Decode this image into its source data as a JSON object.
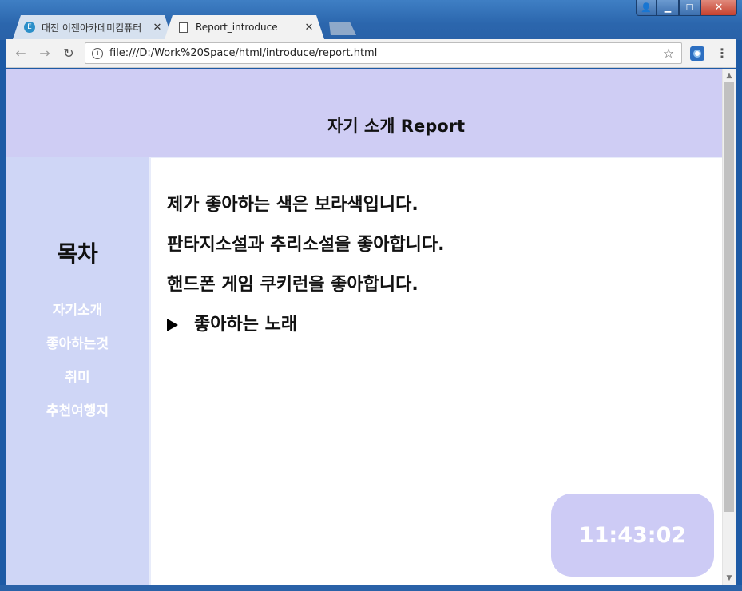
{
  "window": {
    "controls": {
      "user": "👤",
      "minimize": "▁",
      "maximize": "☐",
      "close": "✕"
    }
  },
  "tabs": [
    {
      "title": "대전 이젠아카데미컴퓨터",
      "favicon": "E",
      "close": "✕"
    },
    {
      "title": "Report_introduce",
      "close": "✕"
    }
  ],
  "toolbar": {
    "back": "←",
    "forward": "→",
    "reload": "↻",
    "url": "file:///D:/Work%20Space/html/introduce/report.html",
    "info": "i",
    "star": "☆",
    "menu": "⋮"
  },
  "page": {
    "header_title": "자기 소개 Report",
    "toc_title": "목차",
    "toc_items": [
      "자기소개",
      "좋아하는것",
      "취미",
      "추천여행지"
    ],
    "lines": [
      "제가 좋아하는 색은 보라색입니다.",
      "판타지소설과 추리소설을 좋아합니다.",
      "핸드폰 게임 쿠키런을 좋아합니다."
    ],
    "details_summary": "좋아하는 노래",
    "clock": "11:43:02"
  },
  "colors": {
    "header_bg": "#cfcdf4",
    "sidebar_bg": "#cfd6f6",
    "clock_bg": "#cdcbf5"
  }
}
